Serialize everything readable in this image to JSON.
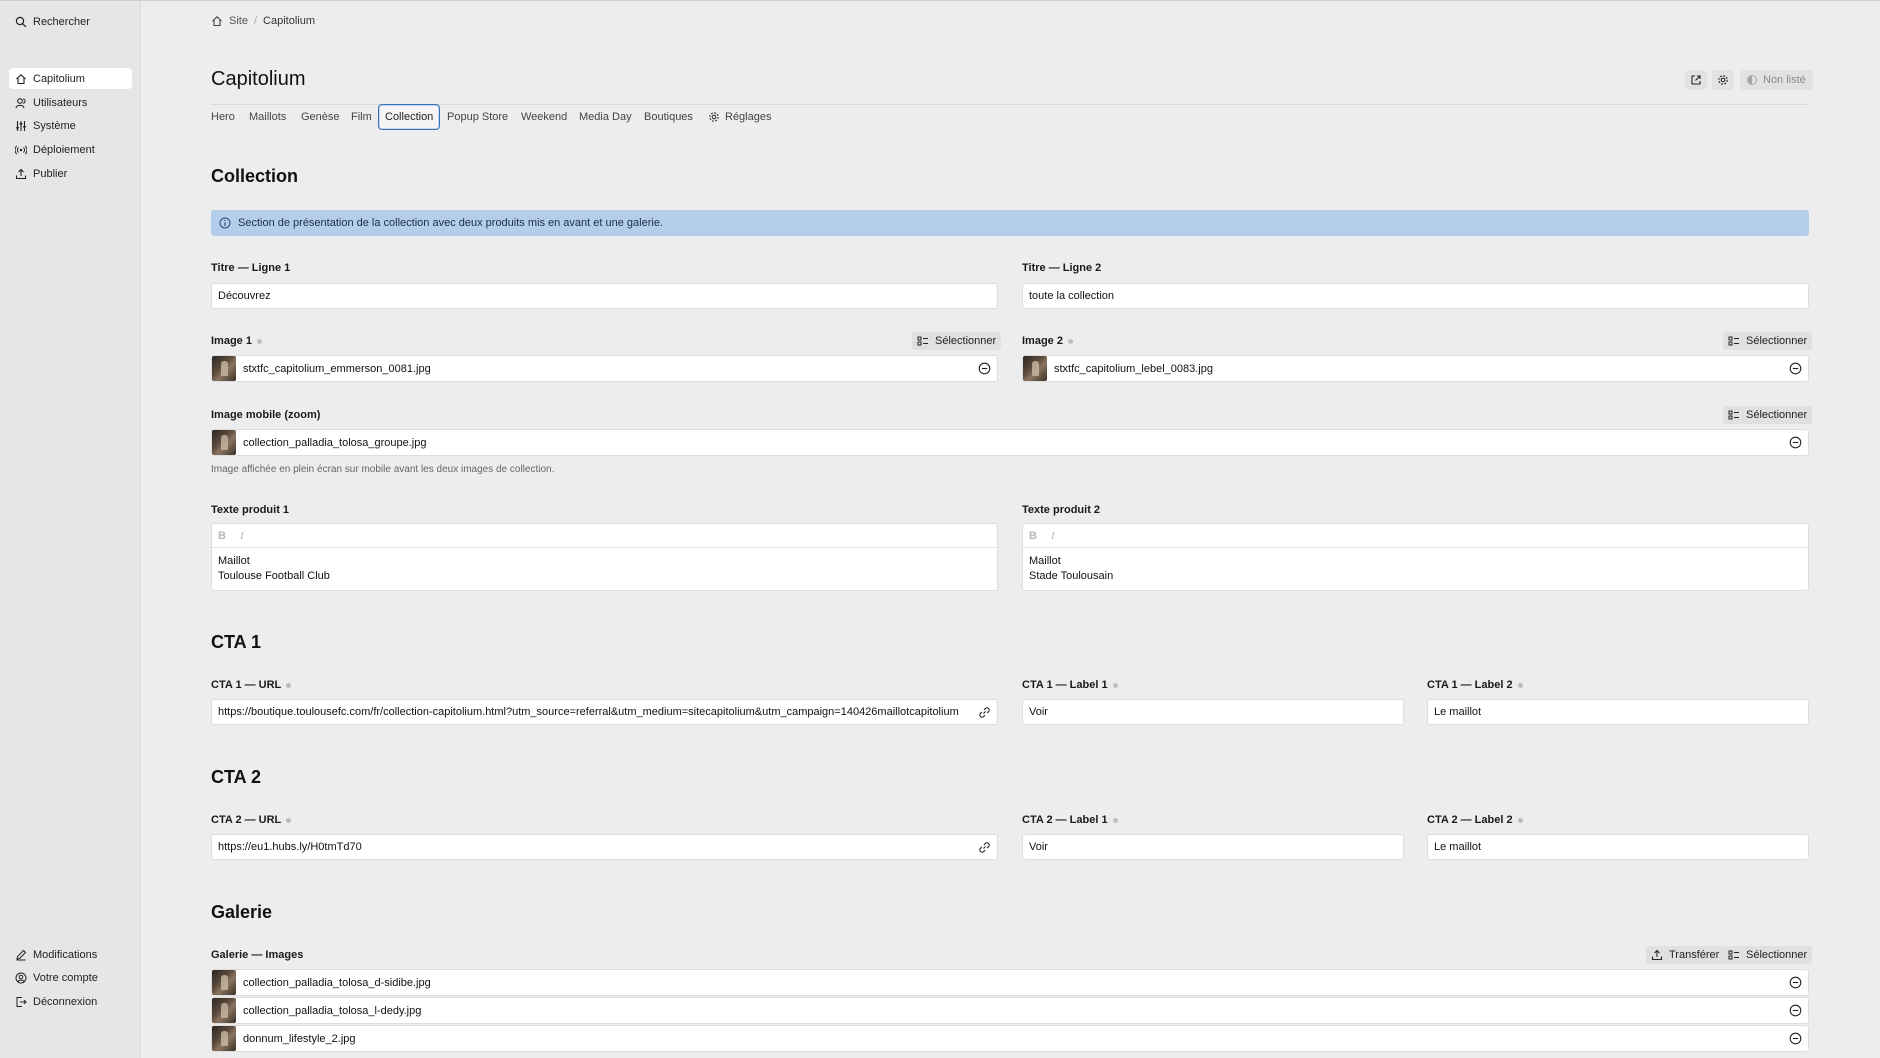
{
  "sidebar": {
    "search_label": "Rechercher",
    "items": [
      {
        "label": "Capitolium",
        "icon": "home-icon",
        "active": true
      },
      {
        "label": "Utilisateurs",
        "icon": "users-icon"
      },
      {
        "label": "Système",
        "icon": "sliders-icon"
      },
      {
        "label": "Déploiement",
        "icon": "broadcast-icon"
      },
      {
        "label": "Publier",
        "icon": "upload-icon"
      }
    ],
    "bottom_items": [
      {
        "label": "Modifications",
        "icon": "pencil-icon"
      },
      {
        "label": "Votre compte",
        "icon": "account-icon"
      },
      {
        "label": "Déconnexion",
        "icon": "logout-icon"
      }
    ]
  },
  "breadcrumb": {
    "root": "Site",
    "current": "Capitolium"
  },
  "page": {
    "title": "Capitolium",
    "status_label": "Non listé"
  },
  "tabs": [
    {
      "label": "Hero"
    },
    {
      "label": "Maillots"
    },
    {
      "label": "Genèse"
    },
    {
      "label": "Film"
    },
    {
      "label": "Collection",
      "active": true
    },
    {
      "label": "Popup Store"
    },
    {
      "label": "Weekend"
    },
    {
      "label": "Media Day"
    },
    {
      "label": "Boutiques"
    },
    {
      "label": "Réglages",
      "icon": "gear-icon"
    }
  ],
  "collection": {
    "title": "Collection",
    "info": "Section de présentation de la collection avec deux produits mis en avant et une galerie.",
    "titre1": {
      "label": "Titre — Ligne 1",
      "value": "Découvrez"
    },
    "titre2": {
      "label": "Titre — Ligne 2",
      "value": "toute la collection"
    },
    "image1": {
      "label": "Image 1",
      "file": "stxtfc_capitolium_emmerson_0081.jpg"
    },
    "image2": {
      "label": "Image 2",
      "file": "stxtfc_capitolium_lebel_0083.jpg"
    },
    "image_mobile": {
      "label": "Image mobile (zoom)",
      "file": "collection_palladia_tolosa_groupe.jpg",
      "hint": "Image affichée en plein écran sur mobile avant les deux images de collection."
    },
    "texte1": {
      "label": "Texte produit 1",
      "line1": "Maillot",
      "line2": "Toulouse Football Club"
    },
    "texte2": {
      "label": "Texte produit 2",
      "line1": "Maillot",
      "line2": "Stade Toulousain"
    },
    "bold_label": "B",
    "italic_label": "I",
    "select_label": "Sélectionner"
  },
  "cta1": {
    "title": "CTA 1",
    "url_label": "CTA 1 — URL",
    "url": "https://boutique.toulousefc.com/fr/collection-capitolium.html?utm_source=referral&utm_medium=sitecapitolium&utm_campaign=140426maillotcapitolium",
    "label1_label": "CTA 1 — Label 1",
    "label1": "Voir",
    "label2_label": "CTA 1 — Label 2",
    "label2": "Le maillot"
  },
  "cta2": {
    "title": "CTA 2",
    "url_label": "CTA 2 — URL",
    "url": "https://eu1.hubs.ly/H0tmTd70",
    "label1_label": "CTA 2 — Label 1",
    "label1": "Voir",
    "label2_label": "CTA 2 — Label 2",
    "label2": "Le maillot"
  },
  "galerie": {
    "title": "Galerie",
    "images_label": "Galerie — Images",
    "upload_label": "Transférer",
    "select_label": "Sélectionner",
    "files": [
      "collection_palladia_tolosa_d-sidibe.jpg",
      "collection_palladia_tolosa_l-dedy.jpg",
      "donnum_lifestyle_2.jpg"
    ]
  }
}
